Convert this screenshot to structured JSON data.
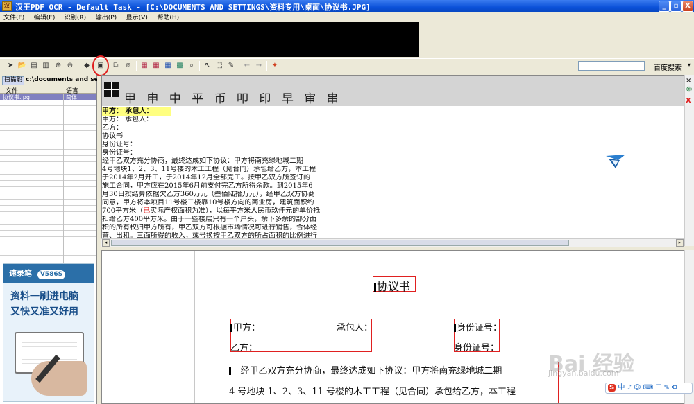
{
  "window": {
    "title": "汉王PDF OCR - Default Task - [C:\\DOCUMENTS AND SETTINGS\\资料专用\\桌面\\协议书.JPG]",
    "minimize": "_",
    "restore": "▫",
    "close": "X"
  },
  "menu": [
    "文件(F)",
    "编辑(E)",
    "识别(R)",
    "输出(P)",
    "显示(V)",
    "帮助(H)"
  ],
  "toolbar": {
    "search_label": "百度搜索",
    "search_value": ""
  },
  "left_panel": {
    "tab": "扫描影",
    "path": "c:\\documents and setti",
    "columns": [
      "文件",
      "语言"
    ],
    "files": [
      {
        "name": "协议书.jpg",
        "language": "简体"
      }
    ]
  },
  "ad": {
    "brand": "速录笔",
    "model": "V586S",
    "line1": "资料一刷进电脑",
    "line2": "又快又准又好用"
  },
  "image_view": {
    "header_text": "甲 申 中 平   币 叩 印 早   审 串",
    "highlight_line": "甲方：          承包人：",
    "lines": [
      "甲方：     承包人：",
      "乙方：",
      "协议书",
      "身份证号：",
      "身份证号：",
      "    经甲乙双方充分协商，最终达成如下协议：甲方将南充绿地城二期",
      "4号地块1、2、3、11号楼的木工工程（见合同）承包给乙方，本工程",
      "于2014年2月开工，于2014年12月全部完工。按甲乙双方所签订的",
      "施工合同，甲方应在2015年6月前支付完乙方所得余款。到2015年6",
      "月30日按结算依据欠乙方360万元（叁佰陆拾万元），经甲乙双方协商",
      "同意，甲方将本项目11号楼二楼靠10号楼方向的商业房，建筑面积约",
      "700平方米（已实际产权面积为准），以每平方米人民币玖仟元的单价抵",
      "扣给乙方400平方米。由于一些楼层只有一个户头，余下多余的部分面",
      "积的所有权归甲方所有，甲乙双方可根据市场情况可进行销售，合体经",
      "营、出租。三面所得的收入，或号换按甲乙双方的所占面积的比例进行"
    ],
    "red_char": "已"
  },
  "document_view": {
    "title": "协议书",
    "party_a": "甲方：",
    "contractor": "承包人：",
    "party_b": "乙方：",
    "id1": "身份证号：",
    "id2": "身份证号：",
    "para1": "经甲乙双方充分协商，最终达成如下协议：甲方将南充绿地城二期",
    "para2": "4 号地块 1、2、3、11 号楼的木工工程（见合同）承包给乙方，本工程"
  },
  "watermark": {
    "text": "Bai 经验",
    "url": "jingyan.baidu.com"
  },
  "ime": {
    "label": "S",
    "text": "中 ♪ ☺ ⌨ ☰ ✎ ⚙"
  }
}
